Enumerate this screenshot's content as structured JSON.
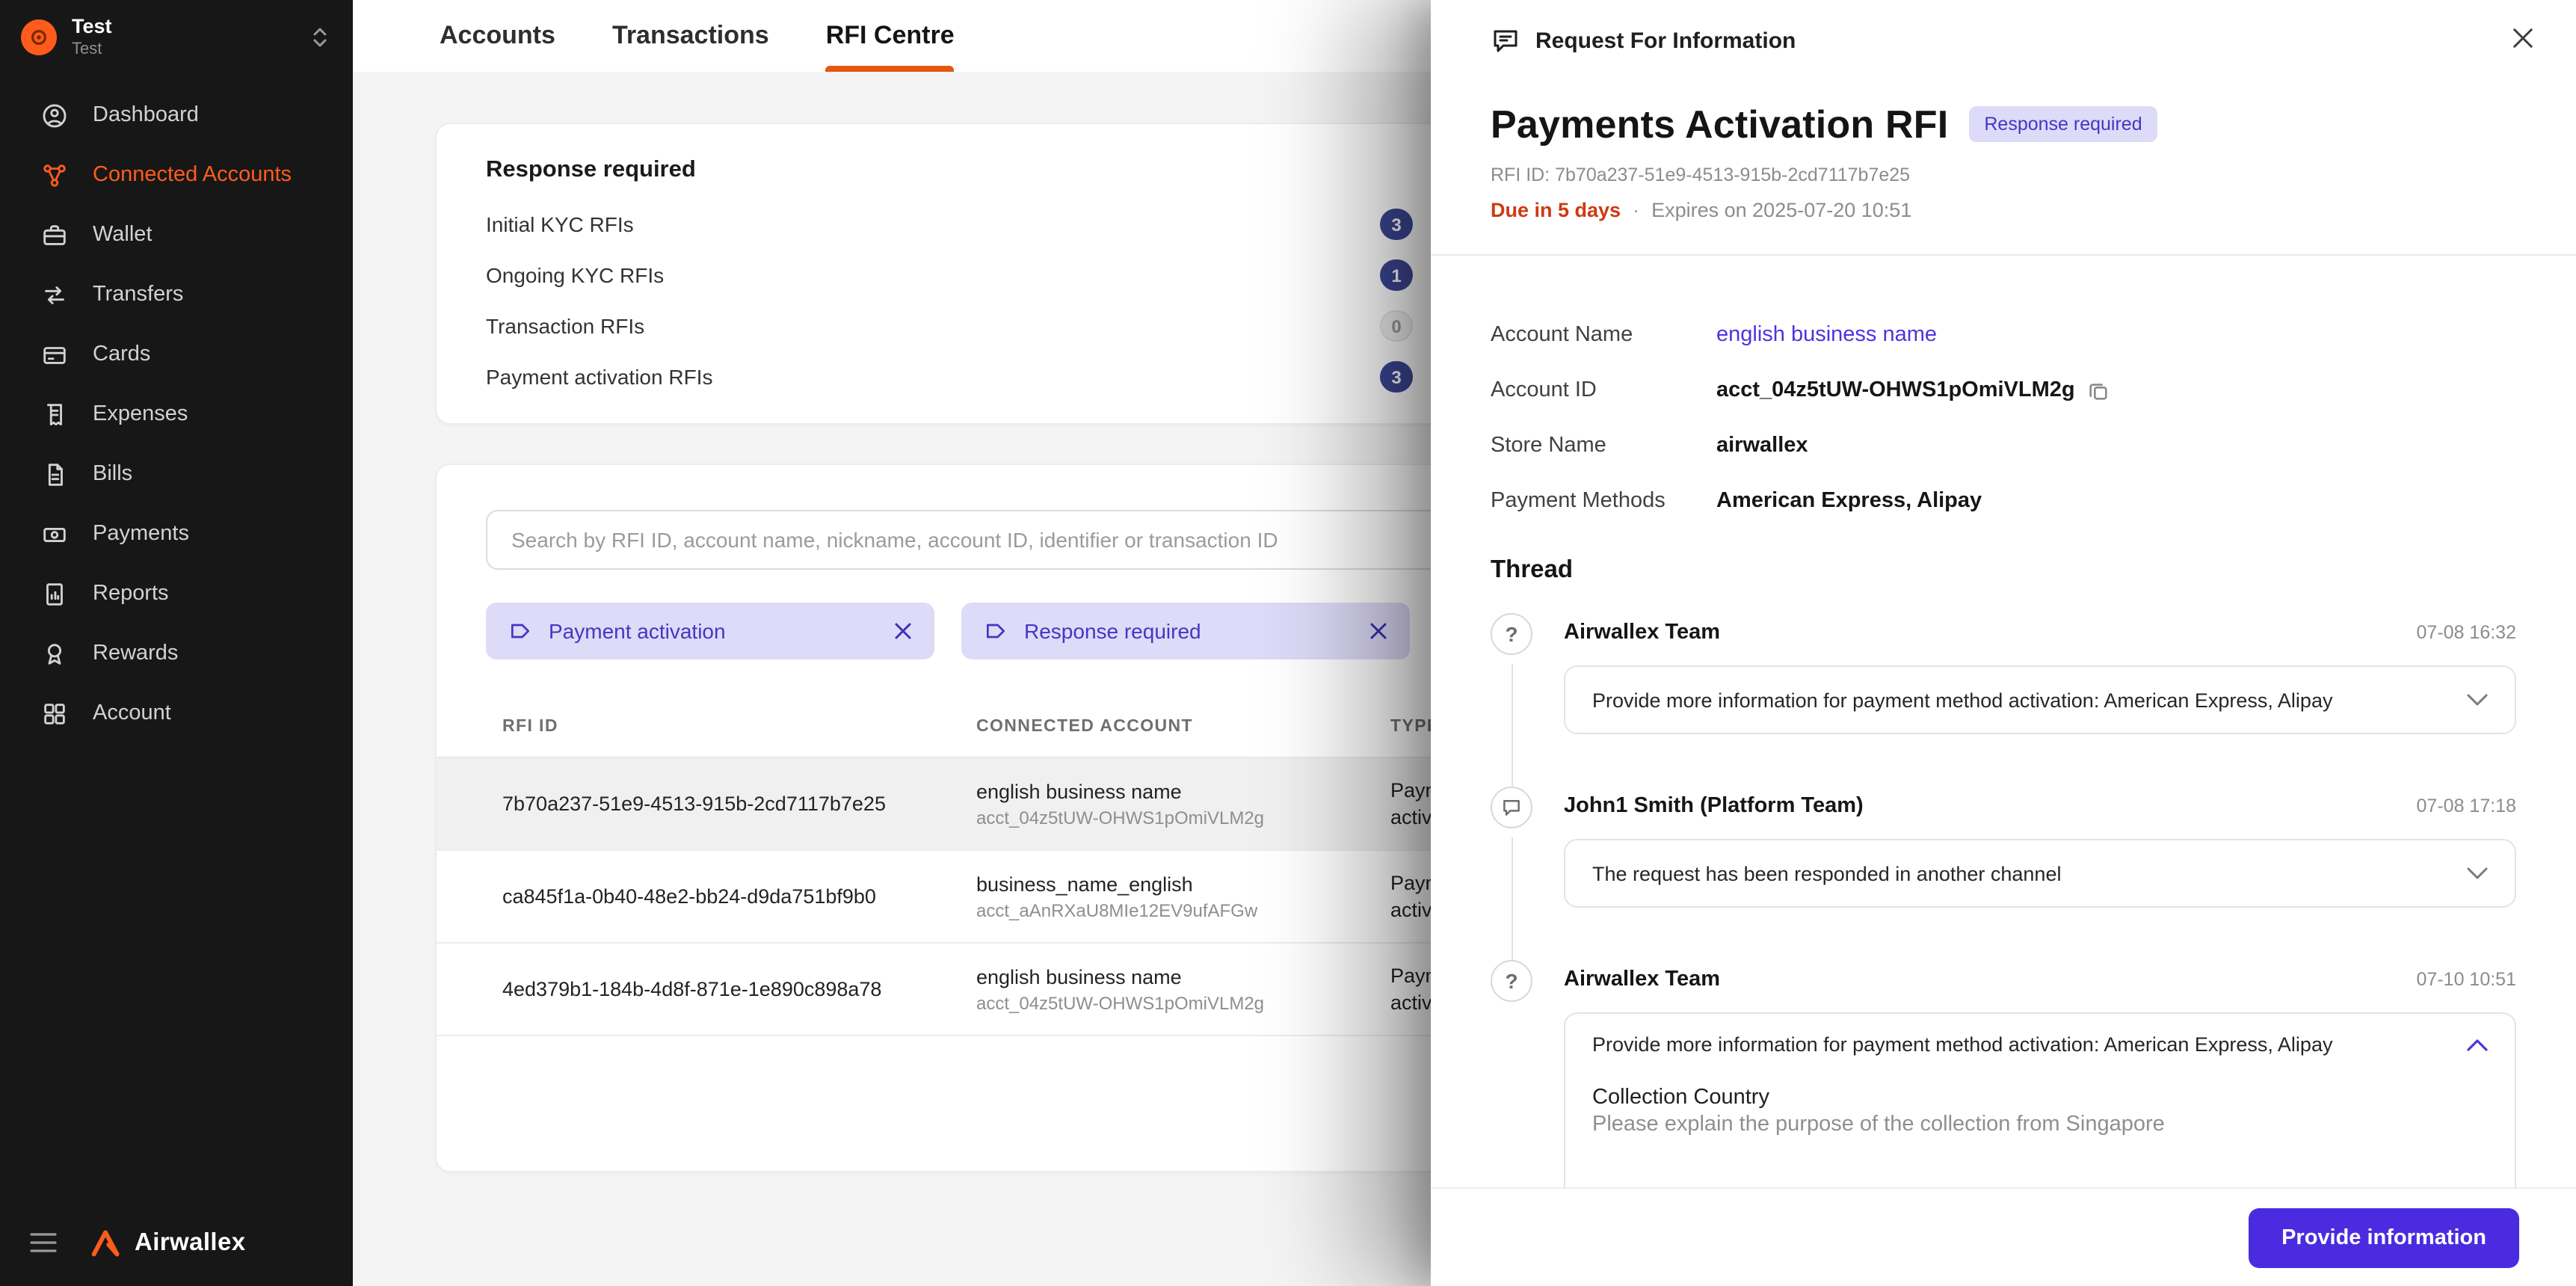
{
  "sidebar": {
    "org": {
      "name": "Test",
      "subtitle": "Test"
    },
    "items": [
      {
        "label": "Dashboard"
      },
      {
        "label": "Connected Accounts",
        "active": true
      },
      {
        "label": "Wallet"
      },
      {
        "label": "Transfers"
      },
      {
        "label": "Cards"
      },
      {
        "label": "Expenses"
      },
      {
        "label": "Bills"
      },
      {
        "label": "Payments"
      },
      {
        "label": "Reports"
      },
      {
        "label": "Rewards"
      },
      {
        "label": "Account"
      }
    ],
    "logo_text": "Airwallex"
  },
  "topnav": {
    "tabs": [
      {
        "label": "Accounts"
      },
      {
        "label": "Transactions"
      },
      {
        "label": "RFI Centre",
        "active": true
      }
    ]
  },
  "summary_card": {
    "title": "Response required",
    "rows": [
      {
        "label": "Initial KYC RFIs",
        "count": "3"
      },
      {
        "label": "Ongoing KYC RFIs",
        "count": "1"
      },
      {
        "label": "Transaction RFIs",
        "count": "0"
      },
      {
        "label": "Payment activation RFIs",
        "count": "3"
      }
    ]
  },
  "filters": {
    "search_placeholder": "Search by RFI ID, account name, nickname, account ID, identifier or transaction ID",
    "chips": [
      {
        "label": "Payment activation"
      },
      {
        "label": "Response required"
      }
    ]
  },
  "table": {
    "columns": [
      "RFI ID",
      "CONNECTED ACCOUNT",
      "TYPE"
    ],
    "rows": [
      {
        "rfi_id": "7b70a237-51e9-4513-915b-2cd7117b7e25",
        "account_name": "english business name",
        "account_id": "acct_04z5tUW-OHWS1pOmiVLM2g",
        "type": "Payment activation"
      },
      {
        "rfi_id": "ca845f1a-0b40-48e2-bb24-d9da751bf9b0",
        "account_name": "business_name_english",
        "account_id": "acct_aAnRXaU8MIe12EV9ufAFGw",
        "type": "Payment activation"
      },
      {
        "rfi_id": "4ed379b1-184b-4d8f-871e-1e890c898a78",
        "account_name": "english business name",
        "account_id": "acct_04z5tUW-OHWS1pOmiVLM2g",
        "type": "Payment activation"
      }
    ]
  },
  "drawer": {
    "header_title": "Request For Information",
    "title": "Payments Activation RFI",
    "status_badge": "Response required",
    "rfi_id_line": "RFI ID: 7b70a237-51e9-4513-915b-2cd7117b7e25",
    "due_text": "Due in 5 days",
    "separator": "·",
    "expires_text": "Expires on 2025-07-20 10:51",
    "fields": [
      {
        "label": "Account Name",
        "value": "english business name"
      },
      {
        "label": "Account ID",
        "value": "acct_04z5tUW-OHWS1pOmiVLM2g"
      },
      {
        "label": "Store Name",
        "value": "airwallex"
      },
      {
        "label": "Payment Methods",
        "value": "American Express, Alipay"
      }
    ],
    "thread_title": "Thread",
    "thread": [
      {
        "author": "Airwallex Team",
        "timestamp": "07-08 16:32",
        "icon_glyph": "?",
        "message": "Provide more information for payment method activation: American Express, Alipay"
      },
      {
        "author": "John1 Smith (Platform Team)",
        "timestamp": "07-08 17:18",
        "message": "The request has been responded in another channel"
      },
      {
        "author": "Airwallex Team",
        "timestamp": "07-10 10:51",
        "icon_glyph": "?",
        "message": "Provide more information for payment method activation: American Express, Alipay",
        "detail_title": "Collection Country",
        "detail_text": "Please explain the purpose of the collection from Singapore"
      }
    ],
    "footer_button": "Provide information"
  },
  "colors": {
    "brand_orange": "#E8570F",
    "sidebar_active_orange": "#FF5C1C",
    "accent_purple": "#4B2BE0",
    "link_purple": "#5131E0",
    "chip_bg": "#DEDBF8",
    "chip_text": "#4436C4",
    "badge_navy": "#3D4795",
    "due_red": "#CE3A12"
  }
}
